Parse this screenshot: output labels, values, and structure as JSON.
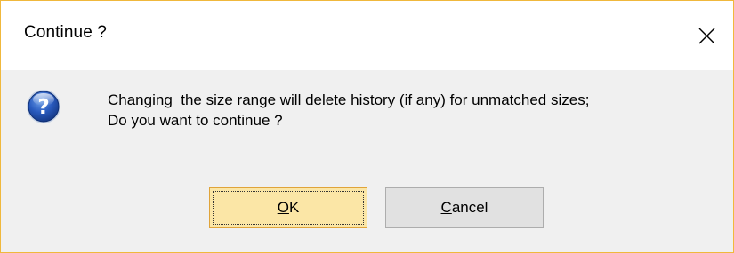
{
  "dialog": {
    "title": "Continue ?",
    "message_lines": [
      "Changing  the size range will delete history (if any) for unmatched sizes;",
      "Do you want to continue ?"
    ],
    "ok_button": {
      "mnemonic": "O",
      "rest": "K"
    },
    "cancel_button": {
      "mnemonic": "C",
      "rest": "ancel"
    },
    "icons": {
      "close": "close-icon",
      "question": "question-icon"
    },
    "colors": {
      "window_border": "#f0b83c",
      "body_background": "#f0f0f0",
      "ok_background": "#fbe6a6",
      "ok_border": "#e0a43a",
      "cancel_background": "#e1e1e1",
      "icon_blue": "#1f4fa8"
    }
  }
}
